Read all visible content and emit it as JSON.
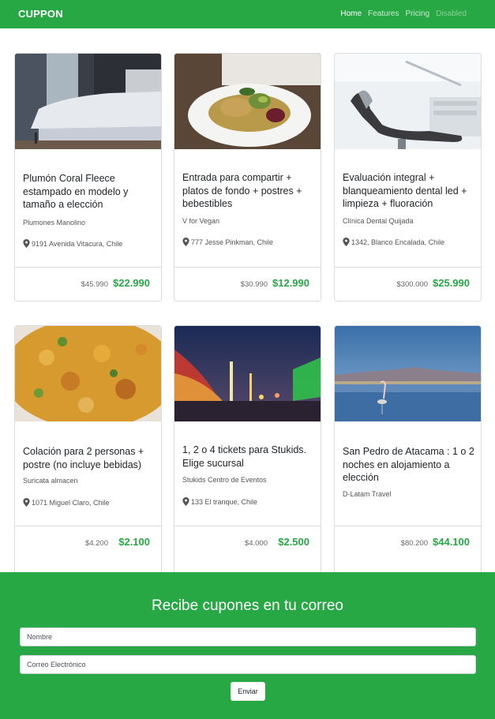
{
  "navbar": {
    "brand": "CUPPON",
    "links": [
      {
        "label": "Home",
        "state": "active"
      },
      {
        "label": "Features",
        "state": "normal"
      },
      {
        "label": "Pricing",
        "state": "normal"
      },
      {
        "label": "Disabled",
        "state": "disabled"
      }
    ]
  },
  "deals": [
    {
      "title": "Plumón Coral Fleece estampado en modelo y tamaño a elección",
      "vendor": "Plumones Manolino",
      "location": "9191 Avenida Vitacura, Chile",
      "old_price": "$45.990",
      "new_price": "$22.990",
      "image": "bedroom-photo"
    },
    {
      "title": "Entrada para compartir + platos de fondo + postres + bebestibles",
      "vendor": "V for Vegan",
      "location": "777 Jesse Pinkman, Chile",
      "old_price": "$30.990",
      "new_price": "$12.990",
      "image": "vegan-dish-photo"
    },
    {
      "title": "Evaluación integral + blanqueamiento dental led + limpieza + fluoración",
      "vendor": "Clínica Dental Quijada",
      "location": "1342, Blanco Encalada, Chile",
      "old_price": "$300.000",
      "new_price": "$25.990",
      "image": "dental-chair-photo"
    },
    {
      "title": "Colación para 2 personas + postre (no incluye bebidas)",
      "vendor": "Suricata almacen",
      "location": "1071 Miguel Claro, Chile",
      "old_price": "$4.200",
      "new_price": "$2.100",
      "image": "stew-photo"
    },
    {
      "title": "1, 2 o 4 tickets para Stukids. Elige sucursal",
      "vendor": "Stukids Centro de Eventos",
      "location": "133 El tranque, Chile",
      "old_price": "$4.000",
      "new_price": "$2.500",
      "image": "fair-rides-photo"
    },
    {
      "title": "San Pedro de Atacama : 1 o 2 noches en alojamiento a elección",
      "vendor": "D-Latam Travel",
      "location": "",
      "old_price": "$80.200",
      "new_price": "$44.100",
      "image": "salt-lake-flamingo-photo"
    }
  ],
  "subscribe": {
    "title": "Recibe cupones en tu correo",
    "name_placeholder": "Nombre",
    "email_placeholder": "Correo Electrónico",
    "button_label": "Enviar"
  },
  "colors": {
    "brand_green": "#28a745",
    "price_green": "#28a745"
  }
}
